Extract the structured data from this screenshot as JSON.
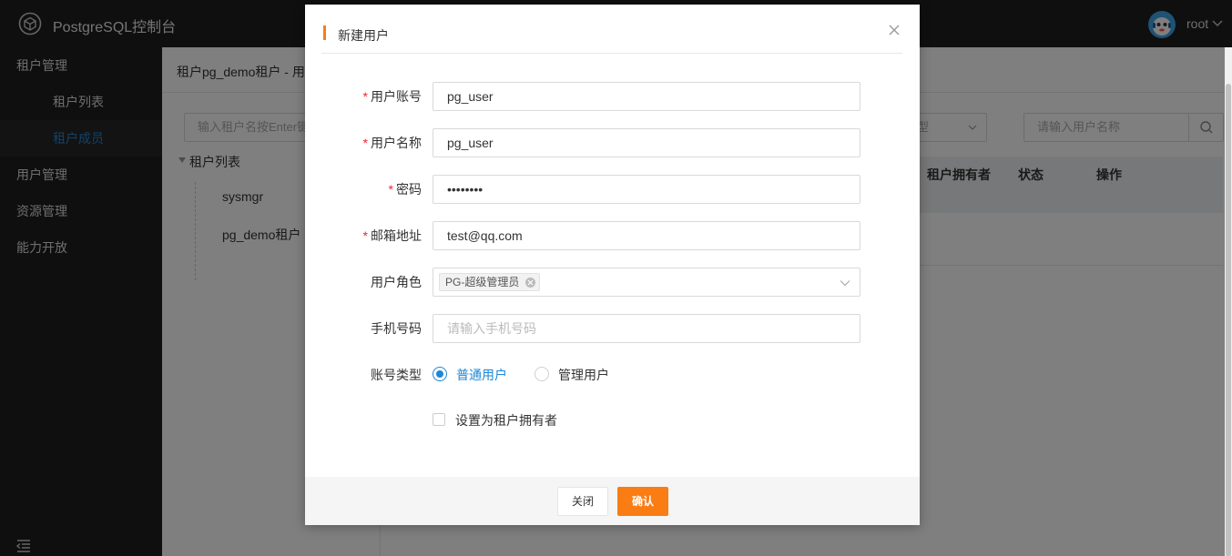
{
  "header": {
    "app_title": "PostgreSQL控制台",
    "user_name": "root"
  },
  "sidebar": {
    "items": [
      {
        "label": "租户管理",
        "level": 1
      },
      {
        "label": "租户列表",
        "level": 2
      },
      {
        "label": "租户成员",
        "level": 2,
        "active": true
      },
      {
        "label": "用户管理",
        "level": 1
      },
      {
        "label": "资源管理",
        "level": 1
      },
      {
        "label": "能力开放",
        "level": 1
      }
    ]
  },
  "content": {
    "breadcrumb": "租户pg_demo租户 - 用",
    "tree_search_placeholder": "输入租户名按Enter键",
    "tree": {
      "root": "租户列表",
      "nodes": [
        "sysmgr",
        "pg_demo租户"
      ]
    },
    "filter_select_text": "型",
    "search_placeholder": "请输入用户名称",
    "table_headers": [
      "租户拥有者",
      "状态",
      "操作"
    ]
  },
  "modal": {
    "title": "新建用户",
    "fields": {
      "account": {
        "label": "用户账号",
        "value": "pg_user",
        "required": true
      },
      "name": {
        "label": "用户名称",
        "value": "pg_user",
        "required": true
      },
      "password": {
        "label": "密码",
        "value": "12345678",
        "required": true
      },
      "email": {
        "label": "邮箱地址",
        "value": "test@qq.com",
        "required": true
      },
      "role": {
        "label": "用户角色",
        "selected_tag": "PG-超级管理员"
      },
      "phone": {
        "label": "手机号码",
        "value": "",
        "placeholder": "请输入手机号码"
      },
      "account_type": {
        "label": "账号类型",
        "options": [
          "普通用户",
          "管理用户"
        ],
        "selected": "普通用户"
      }
    },
    "checkbox_label": "设置为租户拥有者",
    "required_mark": "*",
    "buttons": {
      "cancel": "关闭",
      "confirm": "确认"
    }
  },
  "colors": {
    "accent": "#fa7d14",
    "primary_blue": "#1e87d6",
    "required": "#f5222d",
    "header_bg": "#1e1e1e"
  }
}
